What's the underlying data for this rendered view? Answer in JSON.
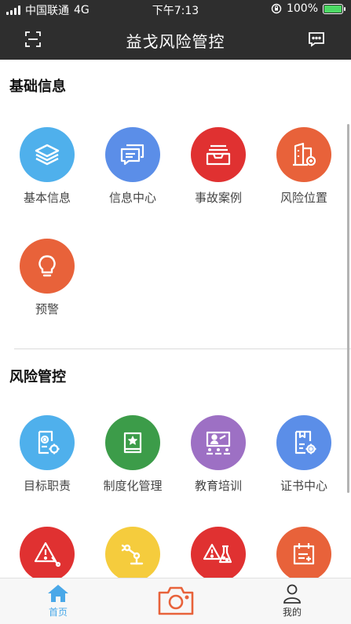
{
  "status_bar": {
    "carrier": "中国联通",
    "network": "4G",
    "time": "下午7:13",
    "battery": "100%",
    "battery_level": 1.0
  },
  "header": {
    "title": "益戈风险管控",
    "left_icon": "scan-icon",
    "right_icon": "message-icon"
  },
  "sections": [
    {
      "title": "基础信息",
      "items": [
        {
          "label": "基本信息",
          "icon": "layers-icon",
          "color": "#4fb0ec"
        },
        {
          "label": "信息中心",
          "icon": "messages-icon",
          "color": "#5b8ee8"
        },
        {
          "label": "事故案例",
          "icon": "inbox-icon",
          "color": "#e03131"
        },
        {
          "label": "风险位置",
          "icon": "building-location-icon",
          "color": "#e8623a"
        },
        {
          "label": "预警",
          "icon": "lightbulb-icon",
          "color": "#e8623a"
        }
      ]
    },
    {
      "title": "风险管控",
      "items": [
        {
          "label": "目标职责",
          "icon": "target-doc-icon",
          "color": "#4fb0ec"
        },
        {
          "label": "制度化管理",
          "icon": "book-star-icon",
          "color": "#3c9c49"
        },
        {
          "label": "教育培训",
          "icon": "training-board-icon",
          "color": "#9d70c4"
        },
        {
          "label": "证书中心",
          "icon": "certificate-gear-icon",
          "color": "#5b8ee8"
        },
        {
          "label": "",
          "icon": "warning-tools-icon",
          "color": "#e03131"
        },
        {
          "label": "",
          "icon": "robot-arm-icon",
          "color": "#f5cc3d"
        },
        {
          "label": "",
          "icon": "chemical-warning-icon",
          "color": "#e03131"
        },
        {
          "label": "",
          "icon": "calendar-note-icon",
          "color": "#e8623a"
        }
      ]
    }
  ],
  "tab_bar": {
    "home_label": "首页",
    "camera_icon": "camera-icon",
    "mine_label": "我的",
    "active_color": "#4aa8e8",
    "camera_color": "#e8623a"
  }
}
